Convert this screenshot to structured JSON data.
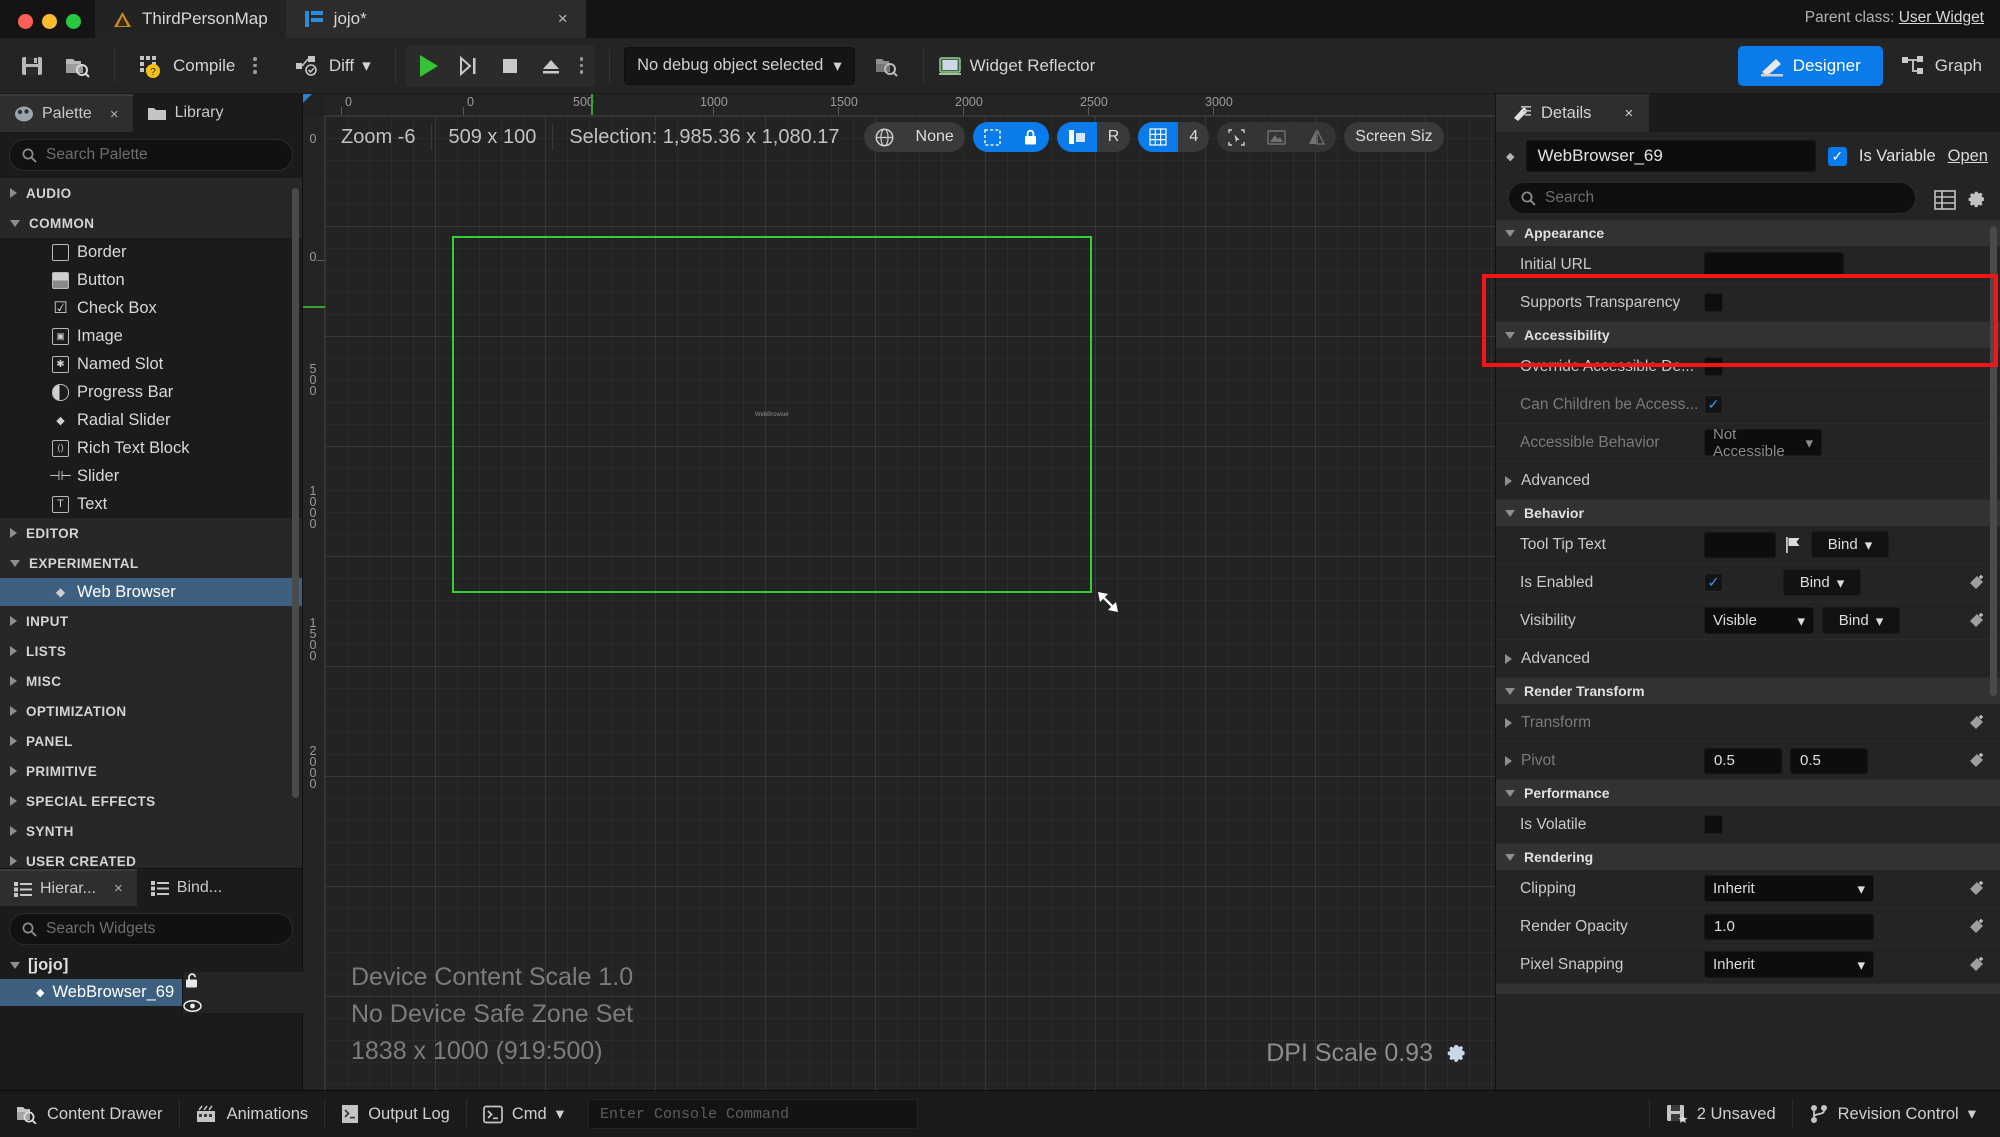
{
  "titlebar": {
    "map_tab": "ThirdPersonMap",
    "asset_tab": "jojo*",
    "close_label": "×",
    "parent_class_prefix": "Parent class:",
    "parent_class_value": "User Widget"
  },
  "toolbar": {
    "save_icon": "save-icon",
    "browse_icon": "browse-icon",
    "compile_label": "Compile",
    "diff_label": "Diff",
    "play_icon": "play-icon",
    "step_icon": "step-icon",
    "stop_icon": "stop-icon",
    "eject_icon": "eject-icon",
    "debug_object": "No debug object selected",
    "widget_reflector": "Widget Reflector",
    "designer_label": "Designer",
    "graph_label": "Graph"
  },
  "palette": {
    "tabs": [
      {
        "label": "Palette",
        "icon": "palette-icon",
        "active": true,
        "closable": true
      },
      {
        "label": "Library",
        "icon": "library-icon",
        "active": false,
        "closable": false
      }
    ],
    "search_placeholder": "Search Palette",
    "categories": [
      {
        "label": "AUDIO",
        "expanded": false,
        "items": []
      },
      {
        "label": "COMMON",
        "expanded": true,
        "items": [
          {
            "label": "Border",
            "icon": "border-icon"
          },
          {
            "label": "Button",
            "icon": "button-icon"
          },
          {
            "label": "Check Box",
            "icon": "checkbox-icon"
          },
          {
            "label": "Image",
            "icon": "image-icon"
          },
          {
            "label": "Named Slot",
            "icon": "named-slot-icon"
          },
          {
            "label": "Progress Bar",
            "icon": "progress-bar-icon"
          },
          {
            "label": "Radial Slider",
            "icon": "radial-slider-icon"
          },
          {
            "label": "Rich Text Block",
            "icon": "rich-text-icon"
          },
          {
            "label": "Slider",
            "icon": "slider-icon"
          },
          {
            "label": "Text",
            "icon": "text-icon"
          }
        ]
      },
      {
        "label": "EDITOR",
        "expanded": false,
        "items": []
      },
      {
        "label": "EXPERIMENTAL",
        "expanded": true,
        "items": [
          {
            "label": "Web Browser",
            "icon": "widget-dot-icon",
            "selected": true
          }
        ]
      },
      {
        "label": "INPUT",
        "expanded": false,
        "items": []
      },
      {
        "label": "LISTS",
        "expanded": false,
        "items": []
      },
      {
        "label": "MISC",
        "expanded": false,
        "items": []
      },
      {
        "label": "OPTIMIZATION",
        "expanded": false,
        "items": []
      },
      {
        "label": "PANEL",
        "expanded": false,
        "items": []
      },
      {
        "label": "PRIMITIVE",
        "expanded": false,
        "items": []
      },
      {
        "label": "SPECIAL EFFECTS",
        "expanded": false,
        "items": []
      },
      {
        "label": "SYNTH",
        "expanded": false,
        "items": []
      },
      {
        "label": "USER CREATED",
        "expanded": false,
        "items": []
      }
    ]
  },
  "hierarchy": {
    "tabs": [
      {
        "label": "Hierar...",
        "active": true,
        "closable": true
      },
      {
        "label": "Bind...",
        "active": false,
        "closable": false
      }
    ],
    "search_placeholder": "Search Widgets",
    "root": "[jojo]",
    "nodes": [
      {
        "label": "WebBrowser_69",
        "selected": true,
        "lock_icon": "unlocked-icon",
        "eye_icon": "eye-icon"
      }
    ]
  },
  "canvas": {
    "zoom_label": "Zoom -6",
    "size_label": "509 x 100",
    "selection_label": "Selection: 1,985.36 x 1,080.17",
    "globe_icon": "globe-icon",
    "none_label": "None",
    "lock_icon": "lock-icon",
    "dashed_icon": "dashed-rect-icon",
    "snap_icon": "snap-icon",
    "r_label": "R",
    "grid_icon": "grid-icon",
    "grid_value": "4",
    "cursor_icon": "select-cursor-icon",
    "image_icon": "image-preview-icon",
    "mirror_icon": "mirror-icon",
    "screen_size_label": "Screen Siz",
    "info_lines": [
      "Device Content Scale 1.0",
      "No Device Safe Zone Set",
      "1838 x 1000 (919:500)"
    ],
    "dpi_label": "DPI Scale 0.93",
    "dpi_settings_icon": "gear-icon",
    "selection_widget_label": "WebBrowser",
    "h_ruler_ticks": [
      "0",
      "0",
      "500",
      "1000",
      "1500",
      "2000",
      "2500",
      "3000"
    ],
    "v_ruler_ticks": [
      "0",
      "0",
      "500",
      "1000",
      "1500",
      "2000"
    ]
  },
  "details": {
    "tab_label": "Details",
    "tab_icon": "details-icon",
    "close_label": "×",
    "widget_name": "WebBrowser_69",
    "is_variable_label": "Is Variable",
    "is_variable_checked": true,
    "open_label": "Open",
    "search_placeholder": "Search",
    "list_view_icon": "list-view-icon",
    "settings_icon": "gear-icon",
    "sections": [
      {
        "name": "Appearance",
        "expanded": true,
        "highlighted": true,
        "rows": [
          {
            "label": "Initial URL",
            "type": "text",
            "value": ""
          },
          {
            "label": "Supports Transparency",
            "type": "checkbox",
            "checked": false
          }
        ]
      },
      {
        "name": "Accessibility",
        "expanded": true,
        "rows": [
          {
            "label": "Override Accessible De...",
            "type": "checkbox",
            "checked": false
          },
          {
            "label": "Can Children be Access...",
            "type": "checkbox",
            "checked": true,
            "disabled": true
          },
          {
            "label": "Accessible Behavior",
            "type": "combo",
            "value": "Not Accessible",
            "disabled": true
          }
        ]
      },
      {
        "name": "Advanced",
        "expanded": false,
        "collapsible_row": true,
        "rows": []
      },
      {
        "name": "Behavior",
        "expanded": true,
        "rows": [
          {
            "label": "Tool Tip Text",
            "type": "text",
            "value": "",
            "flag": true,
            "bind": "Bind"
          },
          {
            "label": "Is Enabled",
            "type": "checkbox",
            "checked": true,
            "bind": "Bind",
            "reset": true
          },
          {
            "label": "Visibility",
            "type": "combo",
            "value": "Visible",
            "bind": "Bind",
            "reset": true
          }
        ]
      },
      {
        "name": "Advanced",
        "expanded": false,
        "collapsible_row": true,
        "rows": []
      },
      {
        "name": "Render Transform",
        "expanded": true,
        "rows": [
          {
            "label": "Transform",
            "type": "expander",
            "reset": true
          },
          {
            "label": "Pivot",
            "type": "vector2",
            "values": [
              "0.5",
              "0.5"
            ],
            "reset": true
          }
        ]
      },
      {
        "name": "Performance",
        "expanded": true,
        "rows": [
          {
            "label": "Is Volatile",
            "type": "checkbox",
            "checked": false
          }
        ]
      },
      {
        "name": "Rendering",
        "expanded": true,
        "rows": [
          {
            "label": "Clipping",
            "type": "combo",
            "value": "Inherit",
            "reset": true
          },
          {
            "label": "Render Opacity",
            "type": "text",
            "value": "1.0",
            "reset": true
          },
          {
            "label": "Pixel Snapping",
            "type": "combo",
            "value": "Inherit",
            "reset": true
          }
        ]
      }
    ],
    "highlight_color": "#f41616"
  },
  "statusbar": {
    "content_drawer": "Content Drawer",
    "animations": "Animations",
    "output_log": "Output Log",
    "cmd_label": "Cmd",
    "console_placeholder": "Enter Console Command",
    "unsaved_label": "2 Unsaved",
    "revision_label": "Revision Control"
  }
}
